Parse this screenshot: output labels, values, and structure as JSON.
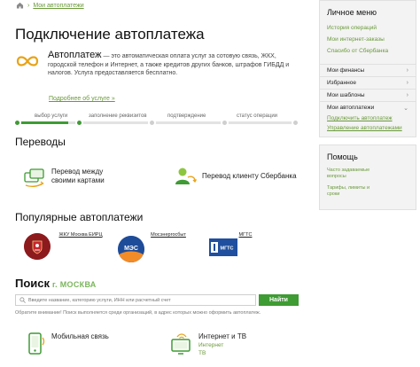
{
  "breadcrumb": {
    "label": "Мои автоплатежи"
  },
  "page": {
    "title": "Подключение автоплатежа"
  },
  "autopay": {
    "heading": "Автоплатеж",
    "description": " — это автоматическая оплата услуг за сотовую связь, ЖКХ, городской телефон и Интернет, а также кредитов других банков, штрафов ГИБДД и налогов. Услуга предоставляется бесплатно.",
    "more_link": "Подробнее об услуге »"
  },
  "steps": {
    "labels": [
      "выбор услуги",
      "заполнение реквизитов",
      "подтверждение",
      "статус операции"
    ],
    "current": 1
  },
  "transfers": {
    "title": "Переводы",
    "items": [
      {
        "label": "Перевод между своими картами"
      },
      {
        "label": "Перевод клиенту Сбербанка"
      }
    ]
  },
  "popular": {
    "title": "Популярные автоплатежи",
    "items": [
      {
        "label": "ЖКУ Москва ЕИРЦ",
        "logo": "coat-of-arms"
      },
      {
        "label": "Мосэнергосбыт",
        "logo": "МЭС"
      },
      {
        "label": "МГТС",
        "logo": "МГТС"
      }
    ]
  },
  "search": {
    "title": "Поиск",
    "city": "г. МОСКВА",
    "placeholder": "Введите название, категорию услуги, ИНН или расчетный счет",
    "button": "Найти",
    "note": "Обратите внимание! Поиск выполняется среди организаций, в адрес которых можно оформить автоплатеж."
  },
  "categories": [
    {
      "label": "Мобильная связь",
      "sub": []
    },
    {
      "label": "Интернет и ТВ",
      "sub": [
        "Интернет",
        "ТВ"
      ]
    }
  ],
  "sidebar": {
    "personal_title": "Личное меню",
    "personal_links": [
      "История операций",
      "Мои интернет-заказы",
      "Спасибо от Сбербанка"
    ],
    "menu": [
      "Мои финансы",
      "Избранное",
      "Мои шаблоны",
      "Мои автоплатежи"
    ],
    "autopay_sub": [
      "Подключить автоплатеж",
      "Управление автоплатежами"
    ],
    "help_title": "Помощь",
    "help_links": [
      "Часто задаваемые вопросы",
      "Тарифы, лимиты и сроки"
    ]
  },
  "colors": {
    "accent": "#3f9b34",
    "link": "#6a9a3a"
  }
}
